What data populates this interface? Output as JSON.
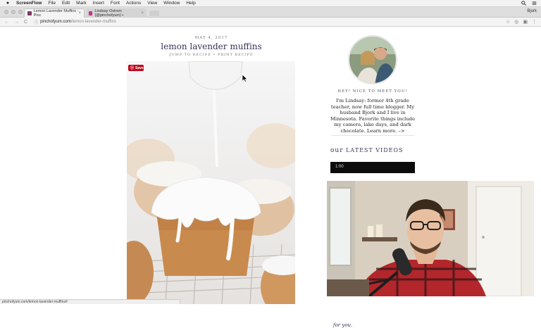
{
  "menubar": {
    "apple": "",
    "app_name": "ScreenFlow",
    "items": [
      "File",
      "Edit",
      "Mark",
      "Insert",
      "Font",
      "Actions",
      "View",
      "Window",
      "Help"
    ],
    "user": "Bjork"
  },
  "tabs": [
    {
      "label": "Lemon Lavender Muffins - Pinc",
      "close": "×",
      "favicon_color": "#7a3b63"
    },
    {
      "label": "Lindsay Ostrom (@pinchofyum) •",
      "close": "×",
      "favicon_color": "#c13584"
    }
  ],
  "address": {
    "host": "pinchofyum.com",
    "path": "/lemon-lavender-muffins",
    "back": "←",
    "forward": "→",
    "reload": "C"
  },
  "post": {
    "date": "MAY 4, 2017",
    "title": "lemon lavender muffins",
    "links": "JUMP TO RECIPE • PRINT RECIPE",
    "save_label": "Save"
  },
  "sidebar": {
    "greeting": "HEY! NICE TO MEET YOU!",
    "bio": "I'm Lindsay: former 4th grade teacher, now full time blogger. My husband Bjork and I live in Minnesota. Favorite things include my camera, lake days, and dark chocolate. Learn more. –>",
    "videos_prefix": "our",
    "videos_heading": "LATEST VIDEOS",
    "video_time": "1:00",
    "below_text": "for you."
  },
  "status_url": "pinchofyum.com/lemon-lavender-muffins#",
  "colors": {
    "brand": "#3b3157",
    "pinterest": "#bd081c"
  }
}
